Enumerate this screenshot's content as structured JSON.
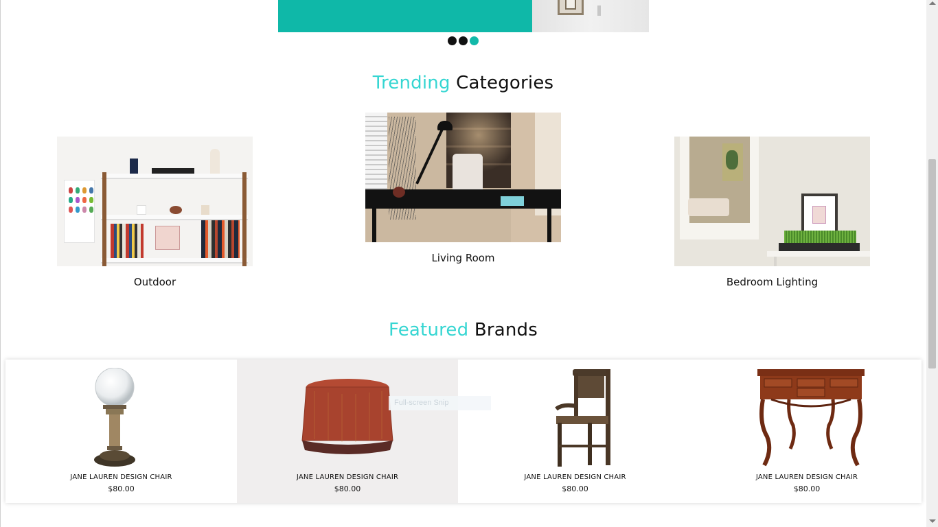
{
  "slider": {
    "dots": [
      {
        "label": "slide-1",
        "active": false
      },
      {
        "label": "slide-2",
        "active": false
      },
      {
        "label": "slide-3",
        "active": true
      }
    ],
    "accent_color": "#0fb8a8"
  },
  "trending": {
    "title_accent": "Trending",
    "title_rest": "Categories",
    "categories": [
      {
        "label": "Outdoor"
      },
      {
        "label": "Living Room"
      },
      {
        "label": "Bedroom Lighting"
      }
    ]
  },
  "featured": {
    "title_accent": "Featured",
    "title_rest": "Brands",
    "products": [
      {
        "name": "JANE LAUREN DESIGN CHAIR",
        "price": "$80.00"
      },
      {
        "name": "JANE LAUREN DESIGN CHAIR",
        "price": "$80.00"
      },
      {
        "name": "JANE LAUREN DESIGN CHAIR",
        "price": "$80.00"
      },
      {
        "name": "JANE LAUREN DESIGN CHAIR",
        "price": "$80.00"
      }
    ]
  },
  "overlay": {
    "snip_tooltip": "Full-screen Snip"
  },
  "colors": {
    "accent": "#36d6d2",
    "teal": "#0fb8a8",
    "text": "#111111"
  }
}
